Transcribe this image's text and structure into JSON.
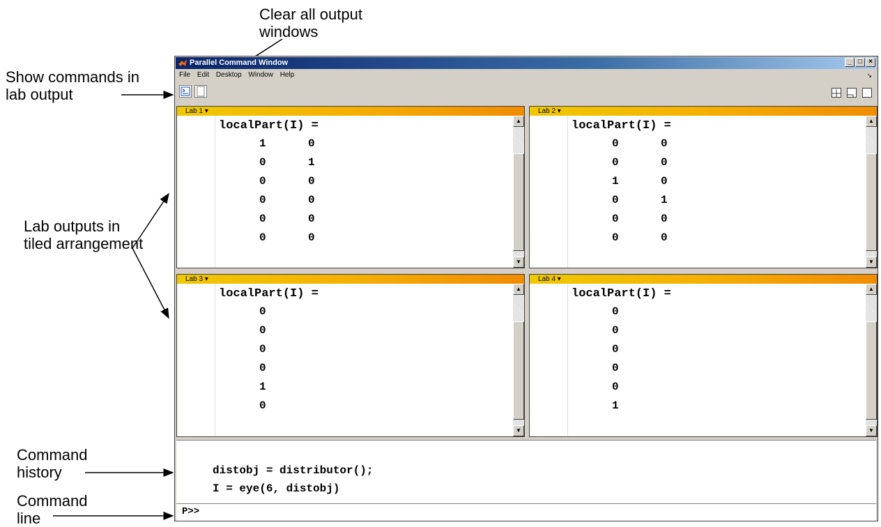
{
  "window": {
    "title": "Parallel Command Window",
    "controls": [
      "_",
      "□",
      "×"
    ],
    "menu": [
      "File",
      "Edit",
      "Desktop",
      "Window",
      "Help"
    ]
  },
  "toolbar": {
    "left_icons": [
      "show-commands-icon",
      "clear-output-icon"
    ],
    "right_icons": [
      "tile-layout-icon",
      "dock-icon",
      "single-window-icon"
    ]
  },
  "labs": [
    {
      "label": "Lab 1 ▾",
      "title": "localPart(I) =",
      "rows": [
        [
          "1",
          "0"
        ],
        [
          "0",
          "1"
        ],
        [
          "0",
          "0"
        ],
        [
          "0",
          "0"
        ],
        [
          "0",
          "0"
        ],
        [
          "0",
          "0"
        ]
      ]
    },
    {
      "label": "Lab 2 ▾",
      "title": "localPart(I) =",
      "rows": [
        [
          "0",
          "0"
        ],
        [
          "0",
          "0"
        ],
        [
          "1",
          "0"
        ],
        [
          "0",
          "1"
        ],
        [
          "0",
          "0"
        ],
        [
          "0",
          "0"
        ]
      ]
    },
    {
      "label": "Lab 3 ▾",
      "title": "localPart(I) =",
      "rows": [
        [
          "0"
        ],
        [
          "0"
        ],
        [
          "0"
        ],
        [
          "0"
        ],
        [
          "1"
        ],
        [
          "0"
        ]
      ]
    },
    {
      "label": "Lab 4 ▾",
      "title": "localPart(I) =",
      "rows": [
        [
          "0"
        ],
        [
          "0"
        ],
        [
          "0"
        ],
        [
          "0"
        ],
        [
          "0"
        ],
        [
          "1"
        ]
      ]
    }
  ],
  "history": [
    "distobj = distributor();",
    "I = eye(6, distobj)"
  ],
  "command_line": {
    "prompt": "P>>",
    "value": ""
  },
  "annotations": {
    "clear": "Clear all output windows",
    "show_commands": "Show commands in lab output",
    "lab_outputs": "Lab outputs in tiled arrangement",
    "command_history": "Command history",
    "command_line": "Command line"
  },
  "colors": {
    "pane_header": "#f5b000",
    "titlebar": "#0a246a"
  }
}
